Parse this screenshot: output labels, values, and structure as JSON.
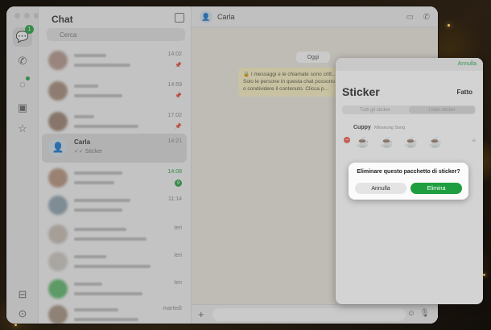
{
  "sidebar": {
    "chats_badge": "1"
  },
  "chat_list": {
    "title": "Chat",
    "search_placeholder": "Cerca",
    "rows": [
      {
        "name": "",
        "message": "",
        "time": "14:02"
      },
      {
        "name": "",
        "message": "",
        "time": "14:59"
      },
      {
        "name": "",
        "message": "",
        "time": "17:02"
      },
      {
        "name": "Carla",
        "message": "✓✓ Sticker",
        "time": "14:21"
      },
      {
        "name": "",
        "message": "",
        "time": "14:08",
        "unread": "9"
      },
      {
        "name": "",
        "message": "",
        "time": "11:14"
      },
      {
        "name": "",
        "message": "",
        "time": "Ieri"
      },
      {
        "name": "",
        "message": "",
        "time": "Ieri"
      },
      {
        "name": "",
        "message": "",
        "time": "Ieri"
      },
      {
        "name": "",
        "message": "",
        "time": "martedì"
      }
    ]
  },
  "conversation": {
    "contact_name": "Carla",
    "date_chip": "Oggi",
    "encryption_line1": "🔒 I messaggi e le chiamate sono critt…",
    "encryption_line2": "Solo le persone in questa chat possono…",
    "encryption_line3": "o condividere il contenuto. Clicca p…"
  },
  "sticker_panel": {
    "top_cancel": "Annulla",
    "title": "Sticker",
    "done": "Fatto",
    "tab_all": "Tutti gli sticker",
    "tab_mine": "I miei sticker",
    "pack_name": "Cuppy",
    "pack_author": "Minseung Song",
    "stickers": [
      "☕",
      "☕",
      "☕",
      "☕"
    ]
  },
  "dialog": {
    "message": "Eliminare questo pacchetto di sticker?",
    "cancel_label": "Annulla",
    "confirm_label": "Elimina"
  },
  "colors": {
    "accent_green": "#25a244",
    "confirm_green": "#1f9e3f",
    "delete_red": "#e4574a"
  }
}
